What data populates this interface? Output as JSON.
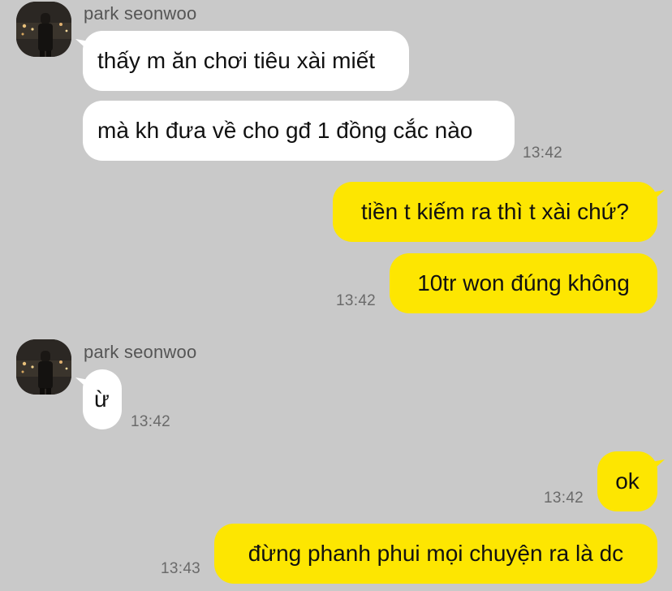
{
  "chat": {
    "messages": [
      {
        "sender": "park seonwoo",
        "text": "thấy m ăn chơi tiêu xài miết"
      },
      {
        "text": "mà kh đưa về cho gđ 1 đồng cắc nào",
        "time": "13:42"
      },
      {
        "text": "tiền t kiếm ra thì t xài chứ?"
      },
      {
        "text": "10tr won đúng không",
        "time": "13:42"
      },
      {
        "sender": "park seonwoo",
        "text": "ừ",
        "time": "13:42"
      },
      {
        "text": "ok",
        "time": "13:42"
      },
      {
        "text": "đừng phanh phui mọi chuyện ra là dc",
        "time": "13:43"
      }
    ]
  },
  "colors": {
    "background": "#c9c9c9",
    "incoming_bubble": "#ffffff",
    "outgoing_bubble": "#fde601"
  }
}
